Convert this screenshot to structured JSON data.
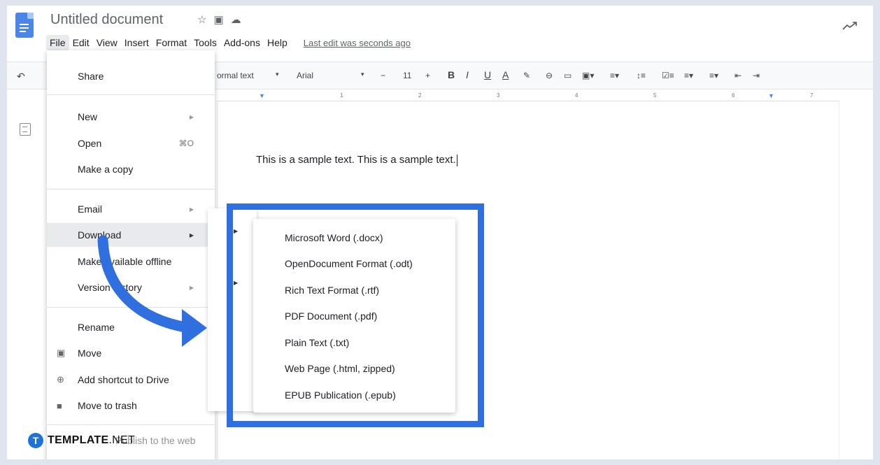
{
  "header": {
    "title": "Untitled document",
    "last_edit": "Last edit was seconds ago"
  },
  "menubar": [
    "File",
    "Edit",
    "View",
    "Insert",
    "Format",
    "Tools",
    "Add-ons",
    "Help"
  ],
  "toolbar": {
    "style": "ormal text",
    "font": "Arial",
    "size": "11",
    "minus": "−",
    "plus": "+",
    "bold": "B",
    "italic": "I",
    "underline": "U",
    "textcolor": "A"
  },
  "ruler": [
    "1",
    "2",
    "3",
    "4",
    "5",
    "6",
    "7"
  ],
  "document": {
    "text": "This is a sample text. This is a sample text."
  },
  "file_menu": {
    "items": [
      {
        "label": "Share"
      },
      {
        "label": "New"
      },
      {
        "label": "Open",
        "shortcut": "⌘O"
      },
      {
        "label": "Make a copy"
      },
      {
        "label": "Email"
      },
      {
        "label": "Download"
      },
      {
        "label": "Make available offline"
      },
      {
        "label": "Version history"
      },
      {
        "label": "Rename"
      },
      {
        "label": "Move"
      },
      {
        "label": "Add shortcut to Drive"
      },
      {
        "label": "Move to trash"
      },
      {
        "label": "Publish to the web"
      }
    ]
  },
  "download_menu": {
    "items": [
      "Microsoft Word (.docx)",
      "OpenDocument Format (.odt)",
      "Rich Text Format (.rtf)",
      "PDF Document (.pdf)",
      "Plain Text (.txt)",
      "Web Page (.html, zipped)",
      "EPUB Publication (.epub)"
    ]
  },
  "watermark": {
    "mark": "T",
    "brand": "TEMPLATE",
    "suffix": ".NET"
  },
  "colors": {
    "highlight_box": "#2f6fe0",
    "arrow": "#2f6fe0"
  }
}
